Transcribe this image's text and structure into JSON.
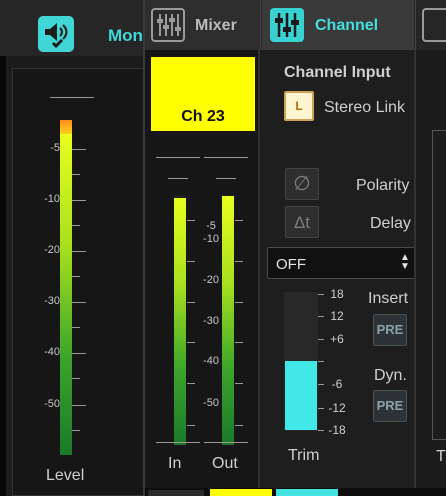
{
  "colors": {
    "accent": "#40d8d8",
    "channel_color": "#ffff00",
    "meter_green_top": "#e8ff1e",
    "meter_green_bottom": "#1a7a2a",
    "trim_fill": "#42e8e8"
  },
  "background_window": {
    "tab_label": "Mon",
    "tab_icon": "speaker-check-icon",
    "meter_scale": [
      "-5",
      "-10",
      "-20",
      "-30",
      "-40",
      "-50"
    ],
    "level_label": "Level"
  },
  "tabs": [
    {
      "label": "Mixer",
      "icon": "mixer-faders-icon",
      "active": false
    },
    {
      "label": "Channel",
      "icon": "channel-sliders-icon",
      "active": true
    }
  ],
  "channel": {
    "name": "Ch 23",
    "meter_scale": [
      "-5",
      "-10",
      "-20",
      "-30",
      "-40",
      "-50"
    ],
    "in_label": "In",
    "out_label": "Out"
  },
  "channel_input": {
    "header": "Channel Input",
    "stereo_link_button": "L",
    "stereo_link_label": "Stereo Link",
    "polarity_label": "Polarity",
    "polarity_icon": "polarity-icon",
    "delay_label": "Delay",
    "delay_icon": "delta-t-icon",
    "delay_value": "OFF",
    "trim_scale": [
      "18",
      "12",
      "+6",
      "-6",
      "-12",
      "-18"
    ],
    "trim_label": "Trim",
    "insert_label": "Insert",
    "insert_button": "PRE",
    "dyn_label": "Dyn.",
    "dyn_button": "PRE"
  },
  "right_edge": {
    "label": "T"
  }
}
